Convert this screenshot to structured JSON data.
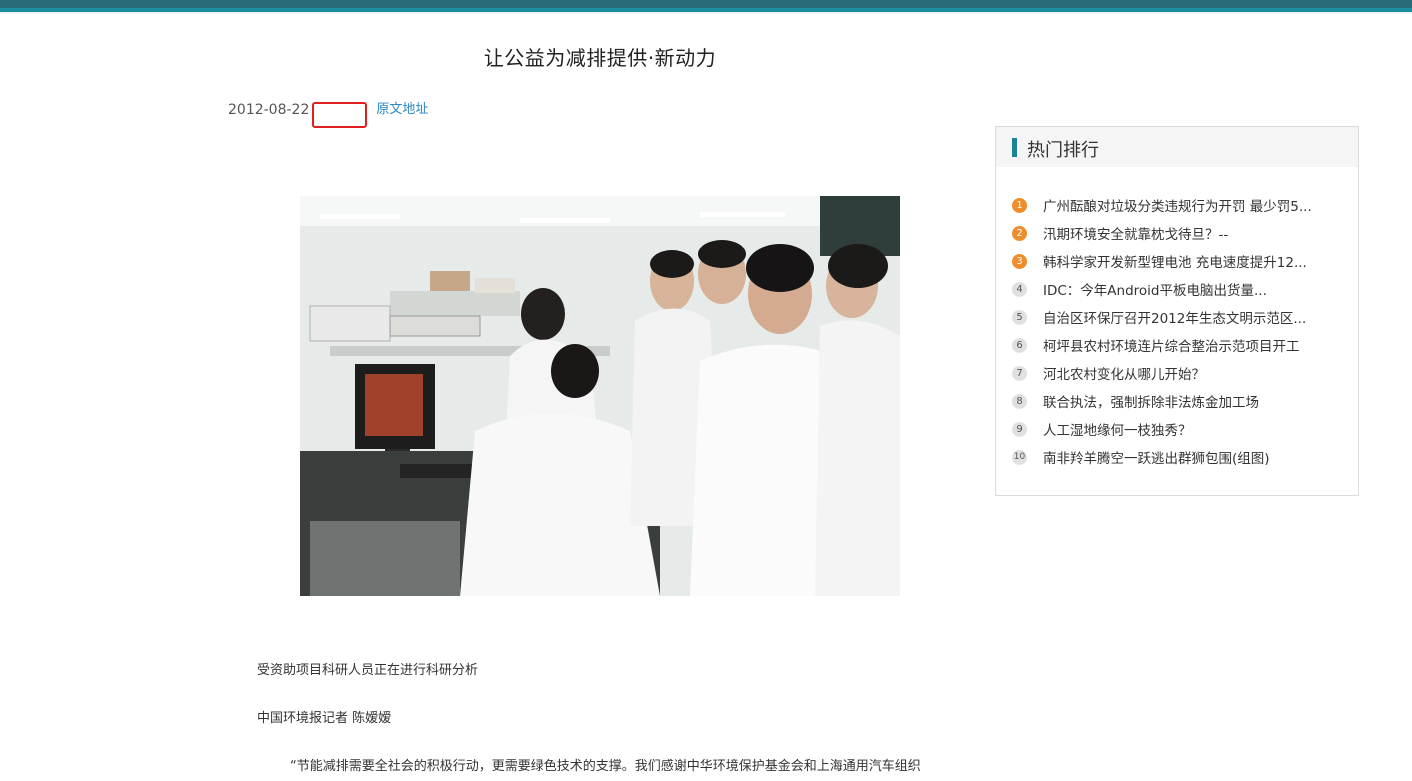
{
  "article": {
    "title": "让公益为减排提供·新动力",
    "date": "2012-08-22",
    "source_link": "原文地址",
    "caption": "受资助项目科研人员正在进行科研分析",
    "reporter": "中国环境报记者 陈嫒嫒",
    "paragraph": "“节能减排需要全社会的积极行动，更需要绿色技术的支撑。我们感谢中华环境保护基金会和上海通用汽车组织"
  },
  "sidebar": {
    "title": "热门排行",
    "accent_color": "#1b8396",
    "hot_color": "#ef8d2c",
    "items": [
      {
        "rank": "1",
        "text": "广州酝酿对垃圾分类违规行为开罚 最少罚5..."
      },
      {
        "rank": "2",
        "text": "汛期环境安全就靠枕戈待旦？--"
      },
      {
        "rank": "3",
        "text": "韩科学家开发新型锂电池 充电速度提升12..."
      },
      {
        "rank": "4",
        "text": "IDC：今年Android平板电脑出货量..."
      },
      {
        "rank": "5",
        "text": "自治区环保厅召开2012年生态文明示范区..."
      },
      {
        "rank": "6",
        "text": "柯坪县农村环境连片综合整治示范项目开工"
      },
      {
        "rank": "7",
        "text": "河北农村变化从哪儿开始？"
      },
      {
        "rank": "8",
        "text": "联合执法，强制拆除非法炼金加工场"
      },
      {
        "rank": "9",
        "text": "人工湿地缘何一枝独秀？"
      },
      {
        "rank": "10",
        "text": "南非羚羊腾空一跃逃出群狮包围(组图)"
      }
    ]
  }
}
